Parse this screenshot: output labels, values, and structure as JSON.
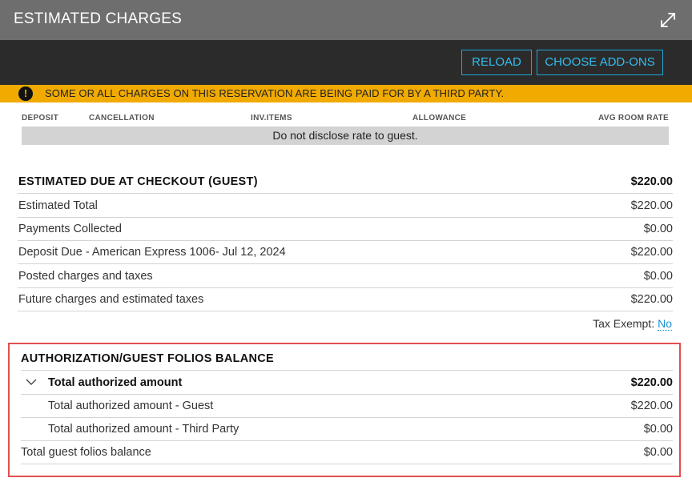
{
  "header": {
    "title": "ESTIMATED CHARGES",
    "expand_icon": "expand-arrows-icon"
  },
  "toolbar": {
    "reload_label": "RELOAD",
    "addons_label": "CHOOSE ADD-ONS"
  },
  "banner": {
    "icon": "exclamation-icon",
    "icon_glyph": "!",
    "message": "SOME OR ALL CHARGES ON THIS RESERVATION ARE BEING PAID FOR BY A THIRD PARTY.",
    "color": "#f0aa00"
  },
  "rate_table": {
    "columns": [
      "DEPOSIT",
      "CANCELLATION",
      "INV.ITEMS",
      "ALLOWANCE",
      "AVG ROOM RATE"
    ],
    "note": "Do not disclose rate to guest."
  },
  "estimated": {
    "heading": {
      "label": "ESTIMATED DUE AT CHECKOUT (GUEST)",
      "value": "$220.00"
    },
    "rows": [
      {
        "label": "Estimated Total",
        "value": "$220.00"
      },
      {
        "label": "Payments Collected",
        "value": "$0.00"
      },
      {
        "label": "Deposit Due - American Express 1006- Jul 12, 2024",
        "value": "$220.00"
      },
      {
        "label": "Posted charges and taxes",
        "value": "$0.00"
      },
      {
        "label": "Future charges and estimated taxes",
        "value": "$220.00"
      }
    ],
    "tax_exempt_label": "Tax Exempt:",
    "tax_exempt_value": "No"
  },
  "authorization": {
    "heading": "AUTHORIZATION/GUEST FOLIOS BALANCE",
    "total": {
      "label": "Total authorized amount",
      "value": "$220.00"
    },
    "sub_rows": [
      {
        "label": "Total authorized amount - Guest",
        "value": "$220.00"
      },
      {
        "label": "Total authorized amount - Third Party",
        "value": "$0.00"
      }
    ],
    "folios": {
      "label": "Total guest folios balance",
      "value": "$0.00"
    },
    "highlight_color": "#e05050"
  }
}
